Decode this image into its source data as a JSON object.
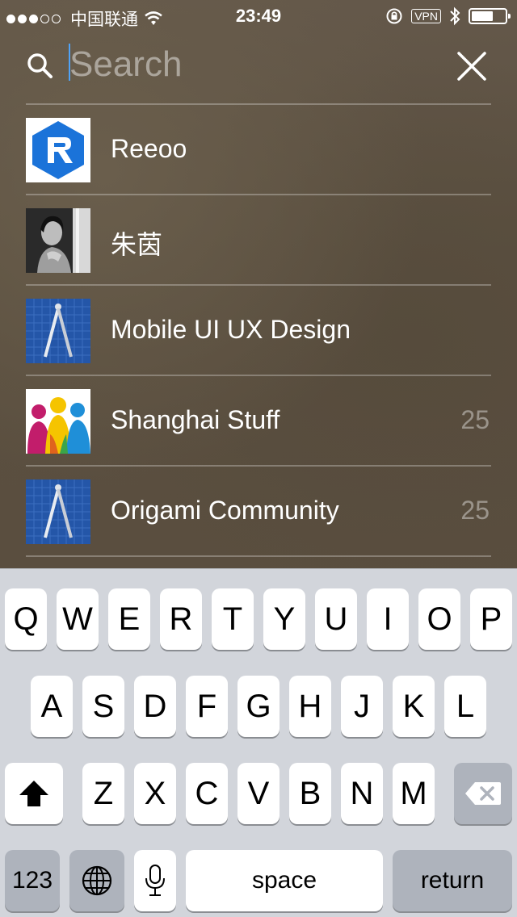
{
  "status_bar": {
    "carrier": "中国联通",
    "time": "23:49",
    "vpn": "VPN",
    "signal_dots_filled": 3,
    "signal_dots_total": 5
  },
  "search": {
    "placeholder": "Search",
    "value": ""
  },
  "results": [
    {
      "label": "Reeoo",
      "count": "",
      "icon": "reeoo-logo"
    },
    {
      "label": "朱茵",
      "count": "",
      "icon": "person-photo"
    },
    {
      "label": "Mobile UI UX Design",
      "count": "",
      "icon": "compass-blueprint"
    },
    {
      "label": "Shanghai Stuff",
      "count": "25",
      "icon": "people-silhouettes"
    },
    {
      "label": "Origami Community",
      "count": "25",
      "icon": "compass-blueprint"
    }
  ],
  "keyboard": {
    "row1": [
      "Q",
      "W",
      "E",
      "R",
      "T",
      "Y",
      "U",
      "I",
      "O",
      "P"
    ],
    "row2": [
      "A",
      "S",
      "D",
      "F",
      "G",
      "H",
      "J",
      "K",
      "L"
    ],
    "row3": [
      "Z",
      "X",
      "C",
      "V",
      "B",
      "N",
      "M"
    ],
    "numbers_label": "123",
    "space_label": "space",
    "return_label": "return"
  },
  "colors": {
    "background": "#5e5343",
    "caret": "#4fa3f7",
    "keyboard": "#d2d5db"
  }
}
